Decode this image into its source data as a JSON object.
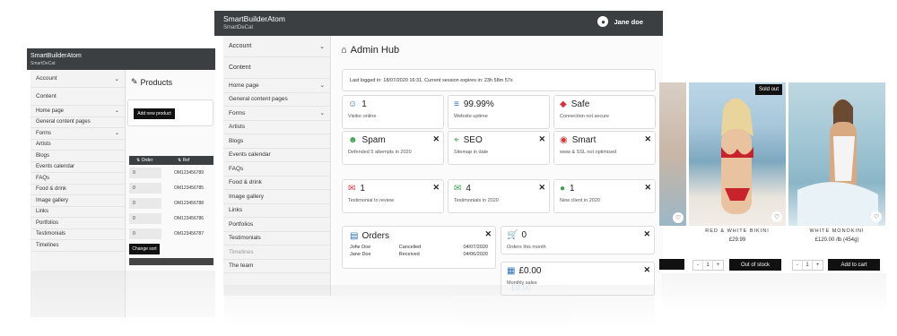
{
  "colors": {
    "topbar": "#3b3f42",
    "sidebar": "#f3f3f3",
    "blue": "#2f6fb2",
    "green": "#3aa04a",
    "red": "#d9323a",
    "black": "#111111"
  },
  "left": {
    "brand": "SmartBuilderAtom",
    "site": "SmartDeCat",
    "sidebar": [
      {
        "label": "Account",
        "icon": "user-icon",
        "chevron": true
      },
      {
        "label": "Content",
        "icon": "edit-icon",
        "chevron": false
      },
      {
        "label": "Home page",
        "chevron": true
      },
      {
        "label": "General content pages",
        "chevron": false
      },
      {
        "label": "Forms",
        "chevron": true
      },
      {
        "label": "Artists",
        "chevron": false
      },
      {
        "label": "Blogs",
        "chevron": false
      },
      {
        "label": "Events calendar",
        "chevron": false
      },
      {
        "label": "FAQs",
        "chevron": false
      },
      {
        "label": "Food & drink",
        "chevron": false
      },
      {
        "label": "Image gallery",
        "chevron": false
      },
      {
        "label": "Links",
        "chevron": false
      },
      {
        "label": "Portfolios",
        "chevron": false
      },
      {
        "label": "Testimonials",
        "chevron": false
      },
      {
        "label": "Timelines",
        "chevron": false
      }
    ],
    "title": "Products",
    "add_label": "Add new product",
    "table": {
      "headers": [
        "Order",
        "Ref"
      ],
      "rows": [
        [
          "0",
          "OM123456789"
        ],
        [
          "0",
          "OM123456785"
        ],
        [
          "0",
          "OM123456788"
        ],
        [
          "0",
          "OM123456786"
        ],
        [
          "0",
          "OM123456787"
        ]
      ]
    },
    "sort_label": "Change sort"
  },
  "middle": {
    "brand": "SmartBuilderAtom",
    "site": "SmartDeCat",
    "user": "Jane doe",
    "sidebar": [
      {
        "label": "Account",
        "chevron": true
      },
      {
        "label": "Content",
        "chevron": false
      },
      {
        "label": "Home page",
        "chevron": true
      },
      {
        "label": "General content pages",
        "chevron": false
      },
      {
        "label": "Forms",
        "chevron": true
      },
      {
        "label": "Artists",
        "chevron": false
      },
      {
        "label": "Blogs",
        "chevron": false
      },
      {
        "label": "Events calendar",
        "chevron": false
      },
      {
        "label": "FAQs",
        "chevron": false
      },
      {
        "label": "Food & drink",
        "chevron": false
      },
      {
        "label": "Image gallery",
        "chevron": false
      },
      {
        "label": "Links",
        "chevron": false
      },
      {
        "label": "Portfolios",
        "chevron": false
      },
      {
        "label": "Testimonials",
        "chevron": false
      },
      {
        "label": "Timelines",
        "chevron": false
      },
      {
        "label": "The team",
        "chevron": false
      }
    ],
    "title": "Admin Hub",
    "login_info": "Last logged in: 18/07/2020 16:31. Current session expires in: 23h 58m 57s",
    "stats_row1": [
      {
        "value": "1",
        "label": "Visitor online",
        "icon": "users-icon",
        "color": "#2f6fb2"
      },
      {
        "value": "99.99%",
        "label": "Website uptime",
        "icon": "server-icon",
        "color": "#2f6fb2"
      },
      {
        "value": "Safe",
        "label": "Connection not secure",
        "icon": "shield-icon",
        "color": "#d9323a"
      }
    ],
    "stats_row2": [
      {
        "value": "Spam",
        "label": "Defended 5 attempts in 2020",
        "icon": "user-shield-icon",
        "color": "#3aa04a"
      },
      {
        "value": "SEO",
        "label": "Sitemap in date",
        "icon": "map-marker-icon",
        "color": "#3aa04a"
      },
      {
        "value": "Smart",
        "label": "www & SSL not optimised",
        "icon": "chrome-icon",
        "color": "#d9323a"
      }
    ],
    "stats_row3": [
      {
        "value": "1",
        "label": "Testimonial to review",
        "icon": "comments-icon",
        "color": "#d9323a"
      },
      {
        "value": "4",
        "label": "Testimonials in 2020",
        "icon": "comments-icon",
        "color": "#3aa04a"
      },
      {
        "value": "1",
        "label": "New client in 2020",
        "icon": "user-circle-icon",
        "color": "#3aa04a"
      }
    ],
    "orders": {
      "title": "Orders",
      "rows": [
        [
          "Jofie Doe",
          "Cancelled",
          "04/07/2020"
        ],
        [
          "Jane Doe",
          "Received",
          "04/06/2020"
        ]
      ]
    },
    "cart": {
      "value": "0",
      "label": "Orders this month"
    },
    "sales": {
      "value": "£0.00",
      "label": "Monthly sales",
      "extra": "£0.00"
    }
  },
  "right": {
    "sold_badge": "Sold out",
    "products": [
      {
        "name": "RED & WHITE BIKINI",
        "price": "£29.99",
        "button": "Out of stock",
        "qty": "1"
      },
      {
        "name": "WHITE MONOKINI",
        "price": "£120.00 /lb (454g)",
        "button": "Add to cart",
        "qty": "1"
      }
    ],
    "qty_minus": "-",
    "qty_plus": "+"
  }
}
